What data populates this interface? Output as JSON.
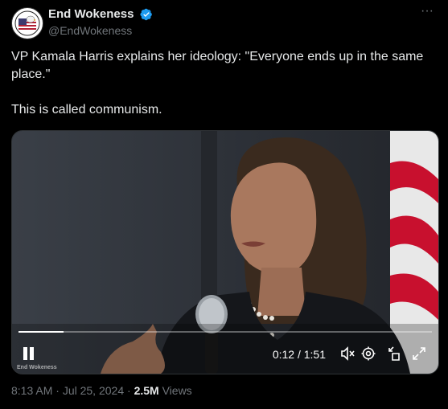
{
  "account": {
    "display_name": "End Wokeness",
    "handle": "@EndWokeness",
    "avatar_icon": "bald-eagle-flag-logo-icon",
    "verified_color": "#1d9bf0"
  },
  "tweet": {
    "line1": "VP Kamala Harris explains her ideology: \"Everyone ends up in the same place.\"",
    "line2": "This is called communism."
  },
  "video": {
    "current_time": "0:12",
    "separator": "/",
    "duration": "1:51",
    "time_display": "0:12 / 1:51",
    "progress_fraction": 0.108,
    "watermark": "End Wokeness",
    "controls": [
      "pause-icon",
      "mute-icon",
      "settings-icon",
      "minimize-icon",
      "fullscreen-icon"
    ]
  },
  "meta": {
    "time": "8:13 AM",
    "date": "Jul 25, 2024",
    "dot": "·",
    "views_count": "2.5M",
    "views_label": "Views"
  },
  "colors": {
    "background": "#000000",
    "text": "#e7e9ea",
    "secondary": "#71767b"
  }
}
